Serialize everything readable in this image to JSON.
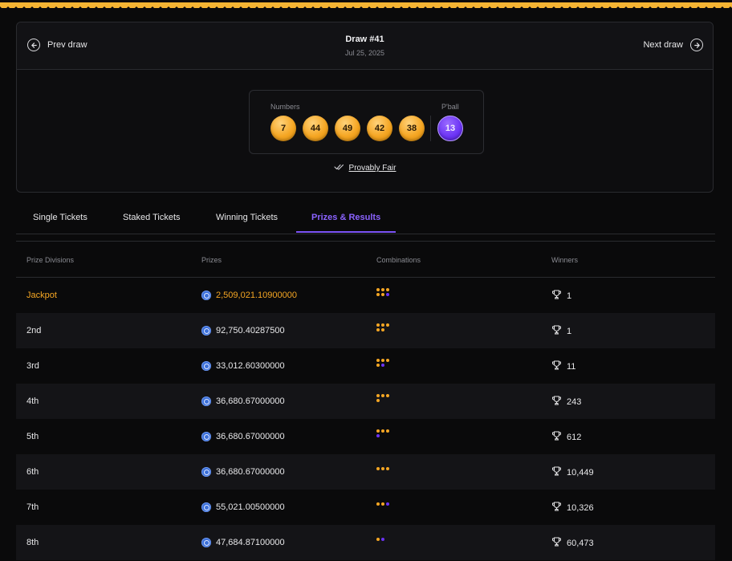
{
  "colors": {
    "accent": "#7b52f5",
    "gold": "#f5a623",
    "background": "#0a0a0b"
  },
  "draw": {
    "prev_label": "Prev draw",
    "next_label": "Next draw",
    "title": "Draw #41",
    "date": "Jul 25, 2025",
    "numbers_label": "Numbers",
    "pball_label": "P'ball",
    "numbers": [
      "7",
      "44",
      "49",
      "42",
      "38"
    ],
    "powerball": "13",
    "provably_fair": "Provably Fair"
  },
  "tabs": [
    {
      "label": "Single Tickets",
      "active": false
    },
    {
      "label": "Staked Tickets",
      "active": false
    },
    {
      "label": "Winning Tickets",
      "active": false
    },
    {
      "label": "Prizes & Results",
      "active": true
    }
  ],
  "table": {
    "headers": [
      "Prize Divisions",
      "Prizes",
      "Combinations",
      "Winners"
    ],
    "rows": [
      {
        "division": "Jackpot",
        "prize": "2,509,021.10900000",
        "combo": "yyyyyp",
        "winners": "1"
      },
      {
        "division": "2nd",
        "prize": "92,750.40287500",
        "combo": "yyyyy",
        "winners": "1"
      },
      {
        "division": "3rd",
        "prize": "33,012.60300000",
        "combo": "yyyyp",
        "winners": "11"
      },
      {
        "division": "4th",
        "prize": "36,680.67000000",
        "combo": "yyyy",
        "winners": "243"
      },
      {
        "division": "5th",
        "prize": "36,680.67000000",
        "combo": "yyyp",
        "winners": "612"
      },
      {
        "division": "6th",
        "prize": "36,680.67000000",
        "combo": "yyy",
        "winners": "10,449"
      },
      {
        "division": "7th",
        "prize": "55,021.00500000",
        "combo": "yyp",
        "winners": "10,326"
      },
      {
        "division": "8th",
        "prize": "47,684.87100000",
        "combo": "yp",
        "winners": "60,473"
      }
    ]
  }
}
